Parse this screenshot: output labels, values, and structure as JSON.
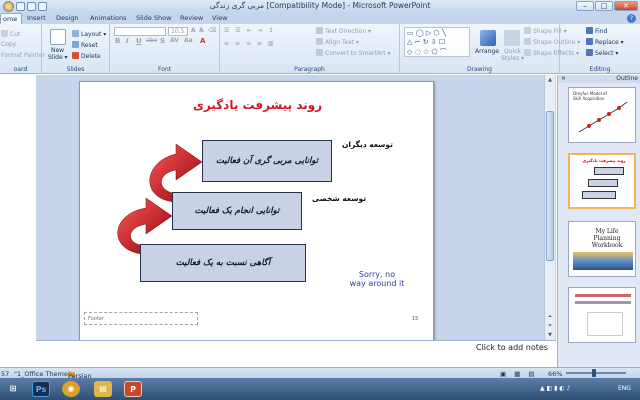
{
  "window": {
    "title": "مربی گری زندگی [Compatibility Mode] - Microsoft PowerPoint",
    "minimize_glyph": "–",
    "maximize_glyph": "□",
    "close_glyph": "✕"
  },
  "tabs": [
    {
      "label": "ome"
    },
    {
      "label": "Insert"
    },
    {
      "label": "Design"
    },
    {
      "label": "Animations"
    },
    {
      "label": "Slide Show"
    },
    {
      "label": "Review"
    },
    {
      "label": "View"
    }
  ],
  "help_glyph": "?",
  "ribbon": {
    "clipboard": {
      "cut": "Cut",
      "copy": "Copy",
      "format_painter": "Format Painter",
      "label": "oard"
    },
    "slides": {
      "new_slide": "New",
      "new_slide_2": "Slide ▾",
      "layout": "Layout ▾",
      "reset": "Reset",
      "delete": "Delete",
      "label": "Slides"
    },
    "font": {
      "font_name": "",
      "font_size": "10.5",
      "label": "Font",
      "bold": "B",
      "italic": "I",
      "underline": "U",
      "strike": "abe",
      "shadow": "S",
      "spacing": "AV",
      "case": "Aa",
      "color": "A"
    },
    "paragraph": {
      "text_direction": "Text Direction ▾",
      "align_text": "Align Text ▾",
      "smartart": "Convert to SmartArt ▾",
      "label": "Paragraph"
    },
    "drawing": {
      "arrange": "Arrange",
      "quick_styles": "Quick",
      "quick_styles_2": "Styles ▾",
      "shape_fill": "Shape Fill ▾",
      "shape_outline": "Shape Outline ▾",
      "shape_effects": "Shape Effects ▾",
      "label": "Drawing"
    },
    "editing": {
      "find": "Find",
      "replace": "Replace ▾",
      "select": "Select ▾",
      "label": "Editing"
    }
  },
  "slide": {
    "title": "روند پیشرفت یادگیری",
    "steps": [
      {
        "text": "توانایی مربی گری آن فعالیت",
        "label": "توسعه دیگران"
      },
      {
        "text": "توانایی انجام یک فعالیت",
        "label": "توسعه شخصی"
      },
      {
        "text": "آگاهی نسبت به یک فعالیت",
        "label": ""
      }
    ],
    "sorry_line1": "Sorry, no",
    "sorry_line2": "way around it",
    "footer": "Footer",
    "slide_number": "15",
    "arrow_color": "#d1121b"
  },
  "notes_placeholder": "Click to add notes",
  "right_panel": {
    "tab_label": "Outline",
    "close_glyph": "×",
    "thumbs": [
      {
        "num": "",
        "title": "Dreyfus Model of Skill Acquisition"
      },
      {
        "num": "",
        "title": "روند پیشرفت یادگیری"
      },
      {
        "num": "",
        "title": "My Life Planning Workbook"
      },
      {
        "num": "",
        "title": ""
      }
    ]
  },
  "status": {
    "slide_info": "57",
    "theme": "\"1_Office Theme\"",
    "language": "Persian",
    "zoom": "66%",
    "language_tray": "ENG"
  },
  "taskbar": {
    "apps": [
      {
        "name": "windows-start",
        "glyph": "⊞",
        "color": "#2b6cb8"
      },
      {
        "name": "photoshop",
        "glyph": "Ps",
        "color": "#1b2f4d"
      },
      {
        "name": "chrome",
        "glyph": "◉",
        "color": "#d9a32a"
      },
      {
        "name": "explorer",
        "glyph": "▤",
        "color": "#e0b64a"
      },
      {
        "name": "powerpoint",
        "glyph": "P",
        "color": "#c9472a"
      }
    ]
  }
}
